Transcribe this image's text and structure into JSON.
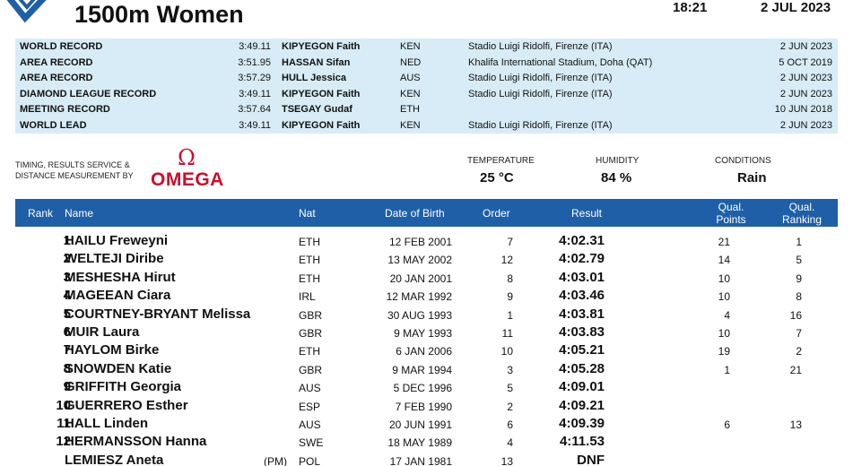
{
  "header": {
    "title": "1500m Women",
    "time": "18:21",
    "date": "2 JUL 2023"
  },
  "records": [
    {
      "type": "WORLD RECORD",
      "mark": "3:49.11",
      "name": "KIPYEGON Faith",
      "nat": "KEN",
      "venue": "Stadio Luigi Ridolfi, Firenze (ITA)",
      "date": "2 JUN 2023"
    },
    {
      "type": "AREA RECORD",
      "mark": "3:51.95",
      "name": "HASSAN Sifan",
      "nat": "NED",
      "venue": "Khalifa International Stadium, Doha (QAT)",
      "date": "5 OCT 2019"
    },
    {
      "type": "AREA RECORD",
      "mark": "3:57.29",
      "name": "HULL Jessica",
      "nat": "AUS",
      "venue": "Stadio Luigi Ridolfi, Firenze (ITA)",
      "date": "2 JUN 2023"
    },
    {
      "type": "DIAMOND LEAGUE RECORD",
      "mark": "3:49.11",
      "name": "KIPYEGON Faith",
      "nat": "KEN",
      "venue": "Stadio Luigi Ridolfi, Firenze (ITA)",
      "date": "2 JUN 2023"
    },
    {
      "type": "MEETING RECORD",
      "mark": "3:57.64",
      "name": "TSEGAY Gudaf",
      "nat": "ETH",
      "venue": "",
      "date": "10 JUN 2018"
    },
    {
      "type": "WORLD LEAD",
      "mark": "3:49.11",
      "name": "KIPYEGON Faith",
      "nat": "KEN",
      "venue": "Stadio Luigi Ridolfi, Firenze (ITA)",
      "date": "2 JUN 2023"
    }
  ],
  "timing": {
    "line1": "TIMING, RESULTS SERVICE &",
    "line2": "DISTANCE MEASUREMENT BY",
    "brand_symbol": "Ω",
    "brand": "OMEGA",
    "brand_color": "#c8102e"
  },
  "weather": {
    "temperature_label": "TEMPERATURE",
    "temperature": "25 °C",
    "humidity_label": "HUMIDITY",
    "humidity": "84 %",
    "conditions_label": "CONDITIONS",
    "conditions": "Rain"
  },
  "columns": {
    "rank": "Rank",
    "name": "Name",
    "nat": "Nat",
    "dob": "Date of Birth",
    "order": "Order",
    "result": "Result",
    "qual_points_1": "Qual.",
    "qual_points_2": "Points",
    "qual_ranking_1": "Qual.",
    "qual_ranking_2": "Ranking"
  },
  "results": [
    {
      "rank": "1",
      "name": "HAILU Freweyni",
      "pm": "",
      "nat": "ETH",
      "dob": "12 FEB 2001",
      "order": "7",
      "result": "4:02.31",
      "qual_points": "21",
      "qual_ranking": "1"
    },
    {
      "rank": "2",
      "name": "WELTEJI Diribe",
      "pm": "",
      "nat": "ETH",
      "dob": "13 MAY 2002",
      "order": "12",
      "result": "4:02.79",
      "qual_points": "14",
      "qual_ranking": "5"
    },
    {
      "rank": "3",
      "name": "MESHESHA Hirut",
      "pm": "",
      "nat": "ETH",
      "dob": "20 JAN 2001",
      "order": "8",
      "result": "4:03.01",
      "qual_points": "10",
      "qual_ranking": "9"
    },
    {
      "rank": "4",
      "name": "MAGEEAN Ciara",
      "pm": "",
      "nat": "IRL",
      "dob": "12 MAR 1992",
      "order": "9",
      "result": "4:03.46",
      "qual_points": "10",
      "qual_ranking": "8"
    },
    {
      "rank": "5",
      "name": "COURTNEY-BRYANT Melissa",
      "pm": "",
      "nat": "GBR",
      "dob": "30 AUG 1993",
      "order": "1",
      "result": "4:03.81",
      "qual_points": "4",
      "qual_ranking": "16"
    },
    {
      "rank": "6",
      "name": "MUIR Laura",
      "pm": "",
      "nat": "GBR",
      "dob": "9 MAY 1993",
      "order": "11",
      "result": "4:03.83",
      "qual_points": "10",
      "qual_ranking": "7"
    },
    {
      "rank": "7",
      "name": "HAYLOM Birke",
      "pm": "",
      "nat": "ETH",
      "dob": "6 JAN 2006",
      "order": "10",
      "result": "4:05.21",
      "qual_points": "19",
      "qual_ranking": "2"
    },
    {
      "rank": "8",
      "name": "SNOWDEN Katie",
      "pm": "",
      "nat": "GBR",
      "dob": "9 MAR 1994",
      "order": "3",
      "result": "4:05.28",
      "qual_points": "1",
      "qual_ranking": "21"
    },
    {
      "rank": "9",
      "name": "GRIFFITH Georgia",
      "pm": "",
      "nat": "AUS",
      "dob": "5 DEC 1996",
      "order": "5",
      "result": "4:09.01",
      "qual_points": "",
      "qual_ranking": ""
    },
    {
      "rank": "10",
      "name": "GUERRERO Esther",
      "pm": "",
      "nat": "ESP",
      "dob": "7 FEB 1990",
      "order": "2",
      "result": "4:09.21",
      "qual_points": "",
      "qual_ranking": ""
    },
    {
      "rank": "11",
      "name": "HALL Linden",
      "pm": "",
      "nat": "AUS",
      "dob": "20 JUN 1991",
      "order": "6",
      "result": "4:09.39",
      "qual_points": "6",
      "qual_ranking": "13"
    },
    {
      "rank": "12",
      "name": "HERMANSSON Hanna",
      "pm": "",
      "nat": "SWE",
      "dob": "18 MAY 1989",
      "order": "4",
      "result": "4:11.53",
      "qual_points": "",
      "qual_ranking": ""
    },
    {
      "rank": "",
      "name": "LEMIESZ Aneta",
      "pm": "(PM)",
      "nat": "POL",
      "dob": "17 JAN 1981",
      "order": "13",
      "result": "DNF",
      "qual_points": "",
      "qual_ranking": ""
    }
  ],
  "colors": {
    "header_bg": "#1f5fa8",
    "records_bg": "#d8ecf7",
    "logo": "#1f5fa8"
  }
}
